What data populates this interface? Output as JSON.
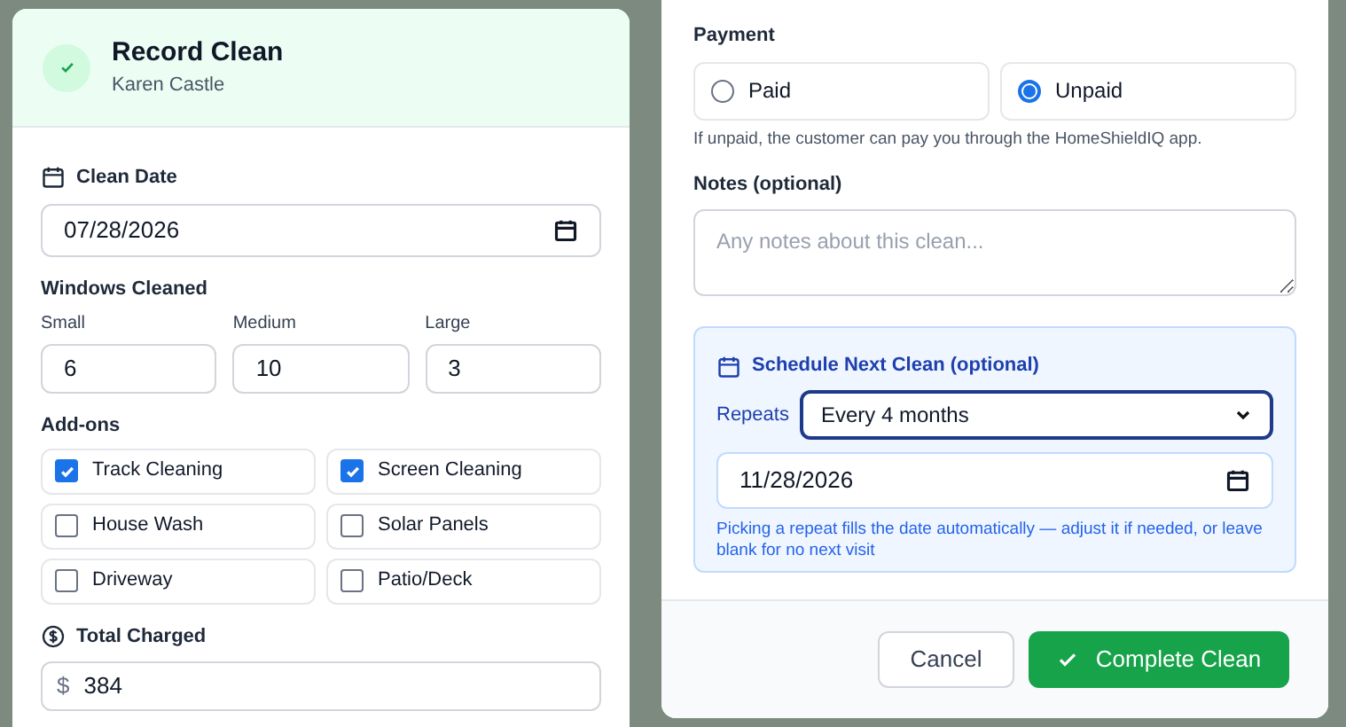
{
  "record_dialog": {
    "title": "Record Clean",
    "customer": "Karen Castle",
    "clean_date": {
      "label": "Clean Date",
      "value": "07/28/2026"
    },
    "windows": {
      "label": "Windows Cleaned",
      "fields": [
        {
          "label": "Small",
          "value": "6"
        },
        {
          "label": "Medium",
          "value": "10"
        },
        {
          "label": "Large",
          "value": "3"
        }
      ]
    },
    "addons": {
      "label": "Add-ons",
      "items": [
        {
          "label": "Track Cleaning",
          "checked": true
        },
        {
          "label": "Screen Cleaning",
          "checked": true
        },
        {
          "label": "House Wash",
          "checked": false
        },
        {
          "label": "Solar Panels",
          "checked": false
        },
        {
          "label": "Driveway",
          "checked": false
        },
        {
          "label": "Patio/Deck",
          "checked": false
        }
      ]
    },
    "total": {
      "label": "Total Charged",
      "currency": "$",
      "value": "384"
    }
  },
  "payment_dialog": {
    "payment": {
      "label": "Payment",
      "options": [
        {
          "label": "Paid",
          "selected": false
        },
        {
          "label": "Unpaid",
          "selected": true
        }
      ],
      "hint": "If unpaid, the customer can pay you through the HomeShieldIQ app."
    },
    "notes": {
      "label": "Notes (optional)",
      "placeholder": "Any notes about this clean..."
    },
    "schedule": {
      "title": "Schedule Next Clean (optional)",
      "repeats_label": "Repeats",
      "repeats_value": "Every 4 months",
      "date": "11/28/2026",
      "hint": "Picking a repeat fills the date automatically — adjust it if needed, or leave blank for no next visit"
    },
    "buttons": [
      {
        "kind": "secondary",
        "label": "Cancel"
      },
      {
        "kind": "primary",
        "label": "Complete Clean"
      }
    ]
  }
}
